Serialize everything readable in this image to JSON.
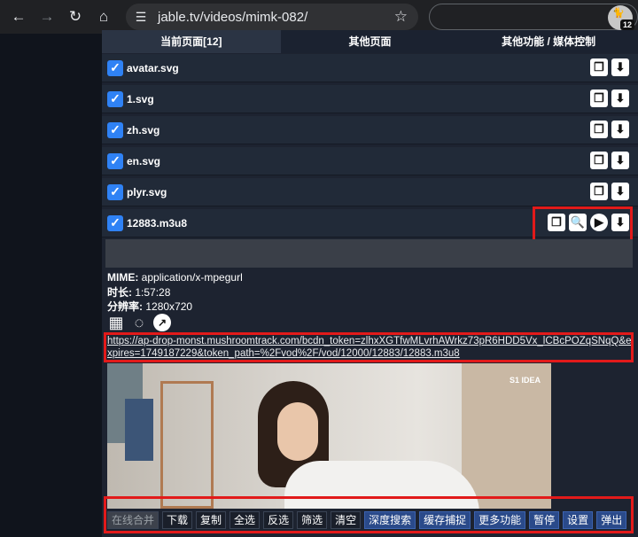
{
  "browser": {
    "url": "jable.tv/videos/mimk-082/",
    "extension_badge": "12"
  },
  "tabs": [
    "当前页面[12]",
    "其他页面",
    "其他功能 / 媒体控制"
  ],
  "files": [
    {
      "name": "avatar.svg",
      "checked": true
    },
    {
      "name": "1.svg",
      "checked": true
    },
    {
      "name": "zh.svg",
      "checked": true
    },
    {
      "name": "en.svg",
      "checked": true
    },
    {
      "name": "plyr.svg",
      "checked": true
    },
    {
      "name": "12883.m3u8",
      "checked": true
    }
  ],
  "details": {
    "mime_label": "MIME:",
    "mime_value": "application/x-mpegurl",
    "duration_label": "时长:",
    "duration_value": "1:57:28",
    "resolution_label": "分辨率:",
    "resolution_value": "1280x720",
    "url": "https://ap-drop-monst.mushroomtrack.com/bcdn_token=zlhxXGTfwMLvrhAWrkz73pR6HDD5Vx_lCBcPOZqSNqQ&expires=1749187229&token_path=%2Fvod%2F/vod/12000/12883/12883.m3u8"
  },
  "buttons": [
    "在线合并",
    "下载",
    "复制",
    "全选",
    "反选",
    "筛选",
    "清空",
    "深度搜索",
    "缓存捕捉",
    "更多功能",
    "暂停",
    "设置",
    "弹出"
  ],
  "video_watermark": "S1 IDEA"
}
